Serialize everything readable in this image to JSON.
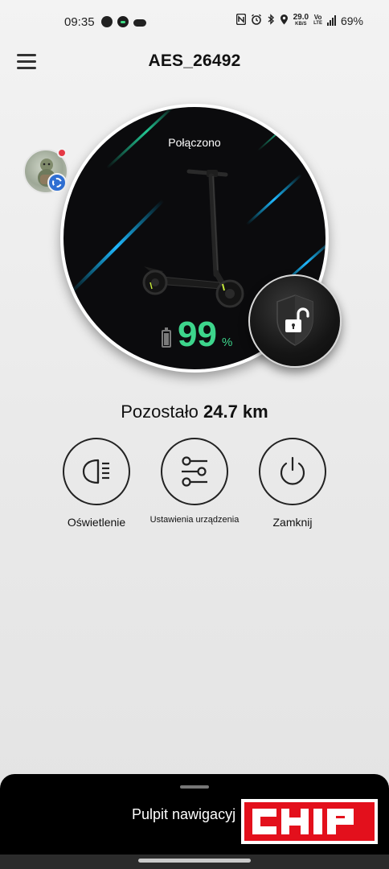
{
  "status_bar": {
    "time": "09:35",
    "net_speed_value": "29.0",
    "net_speed_unit": "KB/S",
    "volte": "Vo",
    "lte": "LTE",
    "battery_percent": "69%"
  },
  "header": {
    "title": "AES_26492",
    "menu_icon": "hamburger-menu-icon"
  },
  "scooter": {
    "connection_status": "Połączono",
    "battery_value": "99",
    "battery_unit": "%",
    "battery_level": 0.99,
    "accent_color": "#3dd58c",
    "lock_icon": "unlocked-shield-icon"
  },
  "range": {
    "label": "Pozostało",
    "value": "24.7 km"
  },
  "actions": [
    {
      "label": "Oświetlenie",
      "icon": "headlight-icon"
    },
    {
      "label": "Ustawienia urządzenia",
      "icon": "sliders-icon"
    },
    {
      "label": "Zamknij",
      "icon": "power-icon"
    }
  ],
  "bottom_sheet": {
    "title": "Pulpit nawigacyj"
  },
  "watermark": {
    "logo_text": "CHIP",
    "color": "#e3101c"
  }
}
